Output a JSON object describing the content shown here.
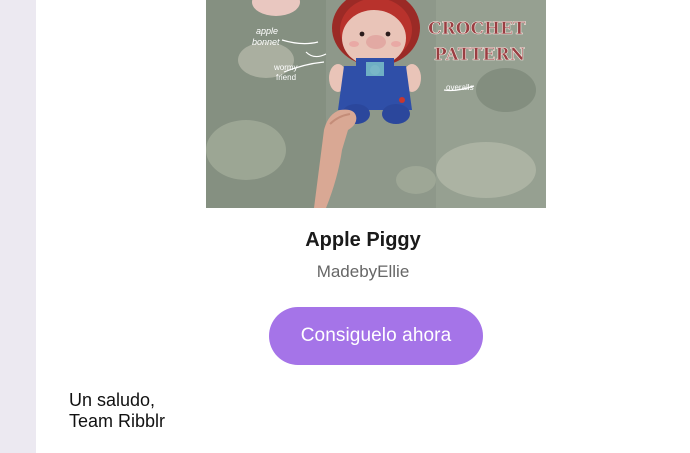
{
  "product": {
    "image_alt": "Apple Piggy crochet pattern photo",
    "image_text": {
      "headline_line1": "CROCHET",
      "headline_line2": "PATTERN",
      "label_apple_bonnet_1": "apple",
      "label_apple_bonnet_2": "bonnet",
      "label_wormy_friend_1": "wormy",
      "label_wormy_friend_2": "friend",
      "label_overalls": "overalls"
    },
    "title": "Apple Piggy",
    "author": "MadebyEllie"
  },
  "cta": {
    "label": "Consiguelo ahora"
  },
  "signoff": {
    "line1": "Un saludo,",
    "line2": "Team Ribblr"
  },
  "colors": {
    "page_background": "#ece9f1",
    "card_background": "#ffffff",
    "button": "#a574e8",
    "button_text": "#ffffff",
    "title_text": "#1a1a1a",
    "author_text": "#666666",
    "pattern_label": "#8b3b3b"
  }
}
